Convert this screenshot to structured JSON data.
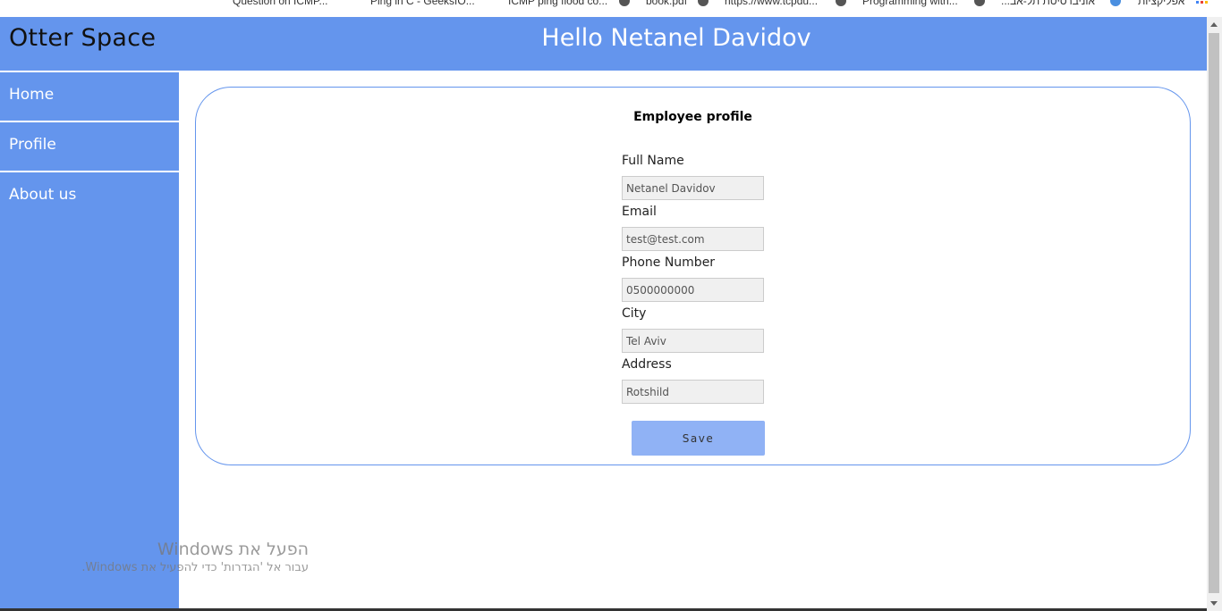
{
  "bookmarks_bar": {
    "items": [
      "Question on ICMP...",
      "Ping in C - GeeksfO...",
      "ICMP ping flood co...",
      "book.pdf",
      "https://www.tcpdu...",
      "Programming with...",
      "...אוניברסיטת תל-אב",
      "אפליקציות"
    ]
  },
  "header": {
    "brand": "Otter Space",
    "greeting": "Hello Netanel Davidov"
  },
  "sidebar": {
    "items": [
      {
        "label": "Home"
      },
      {
        "label": "Profile"
      },
      {
        "label": "About us"
      }
    ]
  },
  "profile_form": {
    "title": "Employee profile",
    "fields": [
      {
        "label": "Full Name",
        "value": "Netanel Davidov"
      },
      {
        "label": "Email",
        "value": "test@test.com"
      },
      {
        "label": "Phone Number",
        "value": "0500000000"
      },
      {
        "label": "City",
        "value": "Tel Aviv"
      },
      {
        "label": "Address",
        "value": "Rotshild"
      }
    ],
    "save_label": "Save"
  },
  "watermark": {
    "line1": "הפעל את Windows",
    "line2": "עבור אל 'הגדרות' כדי להפעיל את Windows."
  },
  "colors": {
    "primary": "#6495ed",
    "button": "#90b2f5"
  }
}
